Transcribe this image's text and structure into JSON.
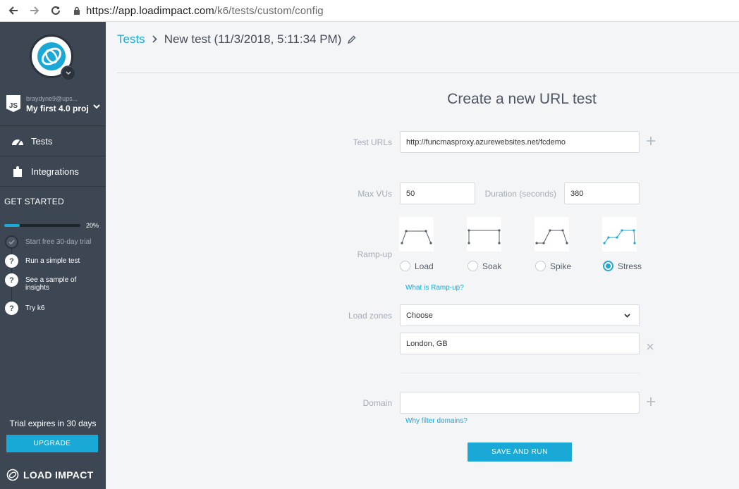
{
  "browser": {
    "url_host": "https://app.loadimpact.com",
    "url_path": "/k6/tests/custom/config"
  },
  "sidebar": {
    "project_user": "braydyne9@ups...",
    "project_name": "My first 4.0 proj",
    "js_badge": "JS",
    "items": [
      {
        "label": "Tests",
        "icon": "speedometer-icon"
      },
      {
        "label": "Integrations",
        "icon": "puzzle-icon"
      }
    ],
    "get_started": "GET STARTED",
    "progress_pct": 20,
    "progress_label": "20%",
    "steps": [
      {
        "label": "Start free 30-day trial",
        "done": true
      },
      {
        "label": "Run a simple test",
        "done": false
      },
      {
        "label": "See a sample of insights",
        "done": false
      },
      {
        "label": "Try k6",
        "done": false
      }
    ],
    "trial_text": "Trial expires in 30 days",
    "upgrade_label": "UPGRADE",
    "brand": "LOAD IMPACT"
  },
  "breadcrumb": {
    "root": "Tests",
    "current": "New test (11/3/2018, 5:11:34 PM)"
  },
  "form": {
    "title": "Create a new URL test",
    "test_urls_label": "Test URLs",
    "test_url_value": "http://funcmasproxy.azurewebsites.net/fcdemo",
    "max_vus_label": "Max VUs",
    "max_vus_value": "50",
    "duration_label": "Duration (seconds)",
    "duration_value": "380",
    "rampup_label": "Ramp-up",
    "rampup_options": [
      {
        "label": "Load",
        "selected": false
      },
      {
        "label": "Soak",
        "selected": false
      },
      {
        "label": "Spike",
        "selected": false
      },
      {
        "label": "Stress",
        "selected": true
      }
    ],
    "rampup_help": "What is Ramp-up?",
    "load_zones_label": "Load zones",
    "load_zones_select": "Choose",
    "load_zone_value": "London, GB",
    "domain_label": "Domain",
    "domain_value": "",
    "domain_help": "Why filter domains?",
    "save_label": "SAVE AND RUN"
  },
  "colors": {
    "accent": "#1aa8d6",
    "sidebar_bg": "#3d4754",
    "page_bg": "#f4f5f7"
  }
}
